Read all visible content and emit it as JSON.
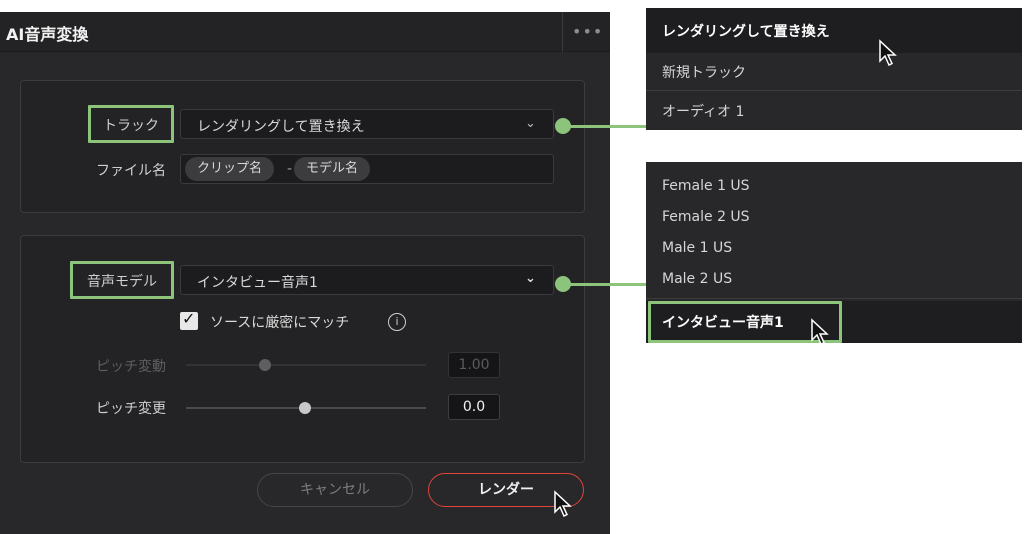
{
  "dialog": {
    "title": "AI音声変換",
    "more_icon": "more-horizontal-icon",
    "track_label": "トラック",
    "track_value": "レンダリングして置き換え",
    "filename_label": "ファイル名",
    "filename_chips": [
      "クリップ名",
      "モデル名"
    ],
    "filename_sep": "-",
    "model_label": "音声モデル",
    "model_value": "インタビュー音声1",
    "strict_match_label": "ソースに厳密にマッチ",
    "strict_match_checked": true,
    "pitch_shift_label": "ピッチ変動",
    "pitch_shift_value": "1.00",
    "pitch_change_label": "ピッチ変更",
    "pitch_change_value": "0.0",
    "cancel_label": "キャンセル",
    "render_label": "レンダー"
  },
  "track_menu": {
    "items": [
      "レンダリングして置き換え",
      "新規トラック",
      "オーディオ 1"
    ],
    "selected_index": 0
  },
  "model_menu": {
    "items": [
      "Female 1 US",
      "Female 2 US",
      "Male 1 US",
      "Male 2 US",
      "インタビュー音声1"
    ],
    "selected_index": 4
  },
  "colors": {
    "highlight": "#8bc47a",
    "render_border": "#e0443a"
  }
}
